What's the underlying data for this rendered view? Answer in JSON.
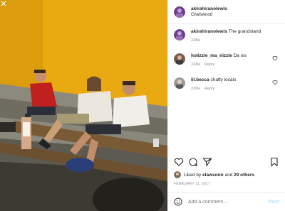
{
  "post": {
    "username": "akirahiranolewis",
    "location": "Chatswood"
  },
  "caption": {
    "username": "akirahiranolewis",
    "text": "The grandstand",
    "age": "228w"
  },
  "comments": [
    {
      "username": "holizzle_ma_nizzle",
      "text": "Da ois",
      "age": "228w",
      "reply": "Reply"
    },
    {
      "username": "lil.becca",
      "text": "chatty locals",
      "age": "228w",
      "reply": "Reply"
    }
  ],
  "likes": {
    "prefix": "Liked by",
    "user": "elawsonn",
    "joiner": "and",
    "others": "29 others"
  },
  "date": "FEBRUARY 11, 2017",
  "add_comment": {
    "placeholder": "Add a comment…",
    "post_label": "Post"
  },
  "icons": {
    "like": "heart-icon",
    "comment": "comment-icon",
    "share": "send-icon",
    "save": "bookmark-icon",
    "emoji": "smiley-icon",
    "comment_like": "heart-icon"
  },
  "colors": {
    "wall": "#f2b31a",
    "link": "#b2dffc",
    "muted": "#8e8e8e"
  }
}
